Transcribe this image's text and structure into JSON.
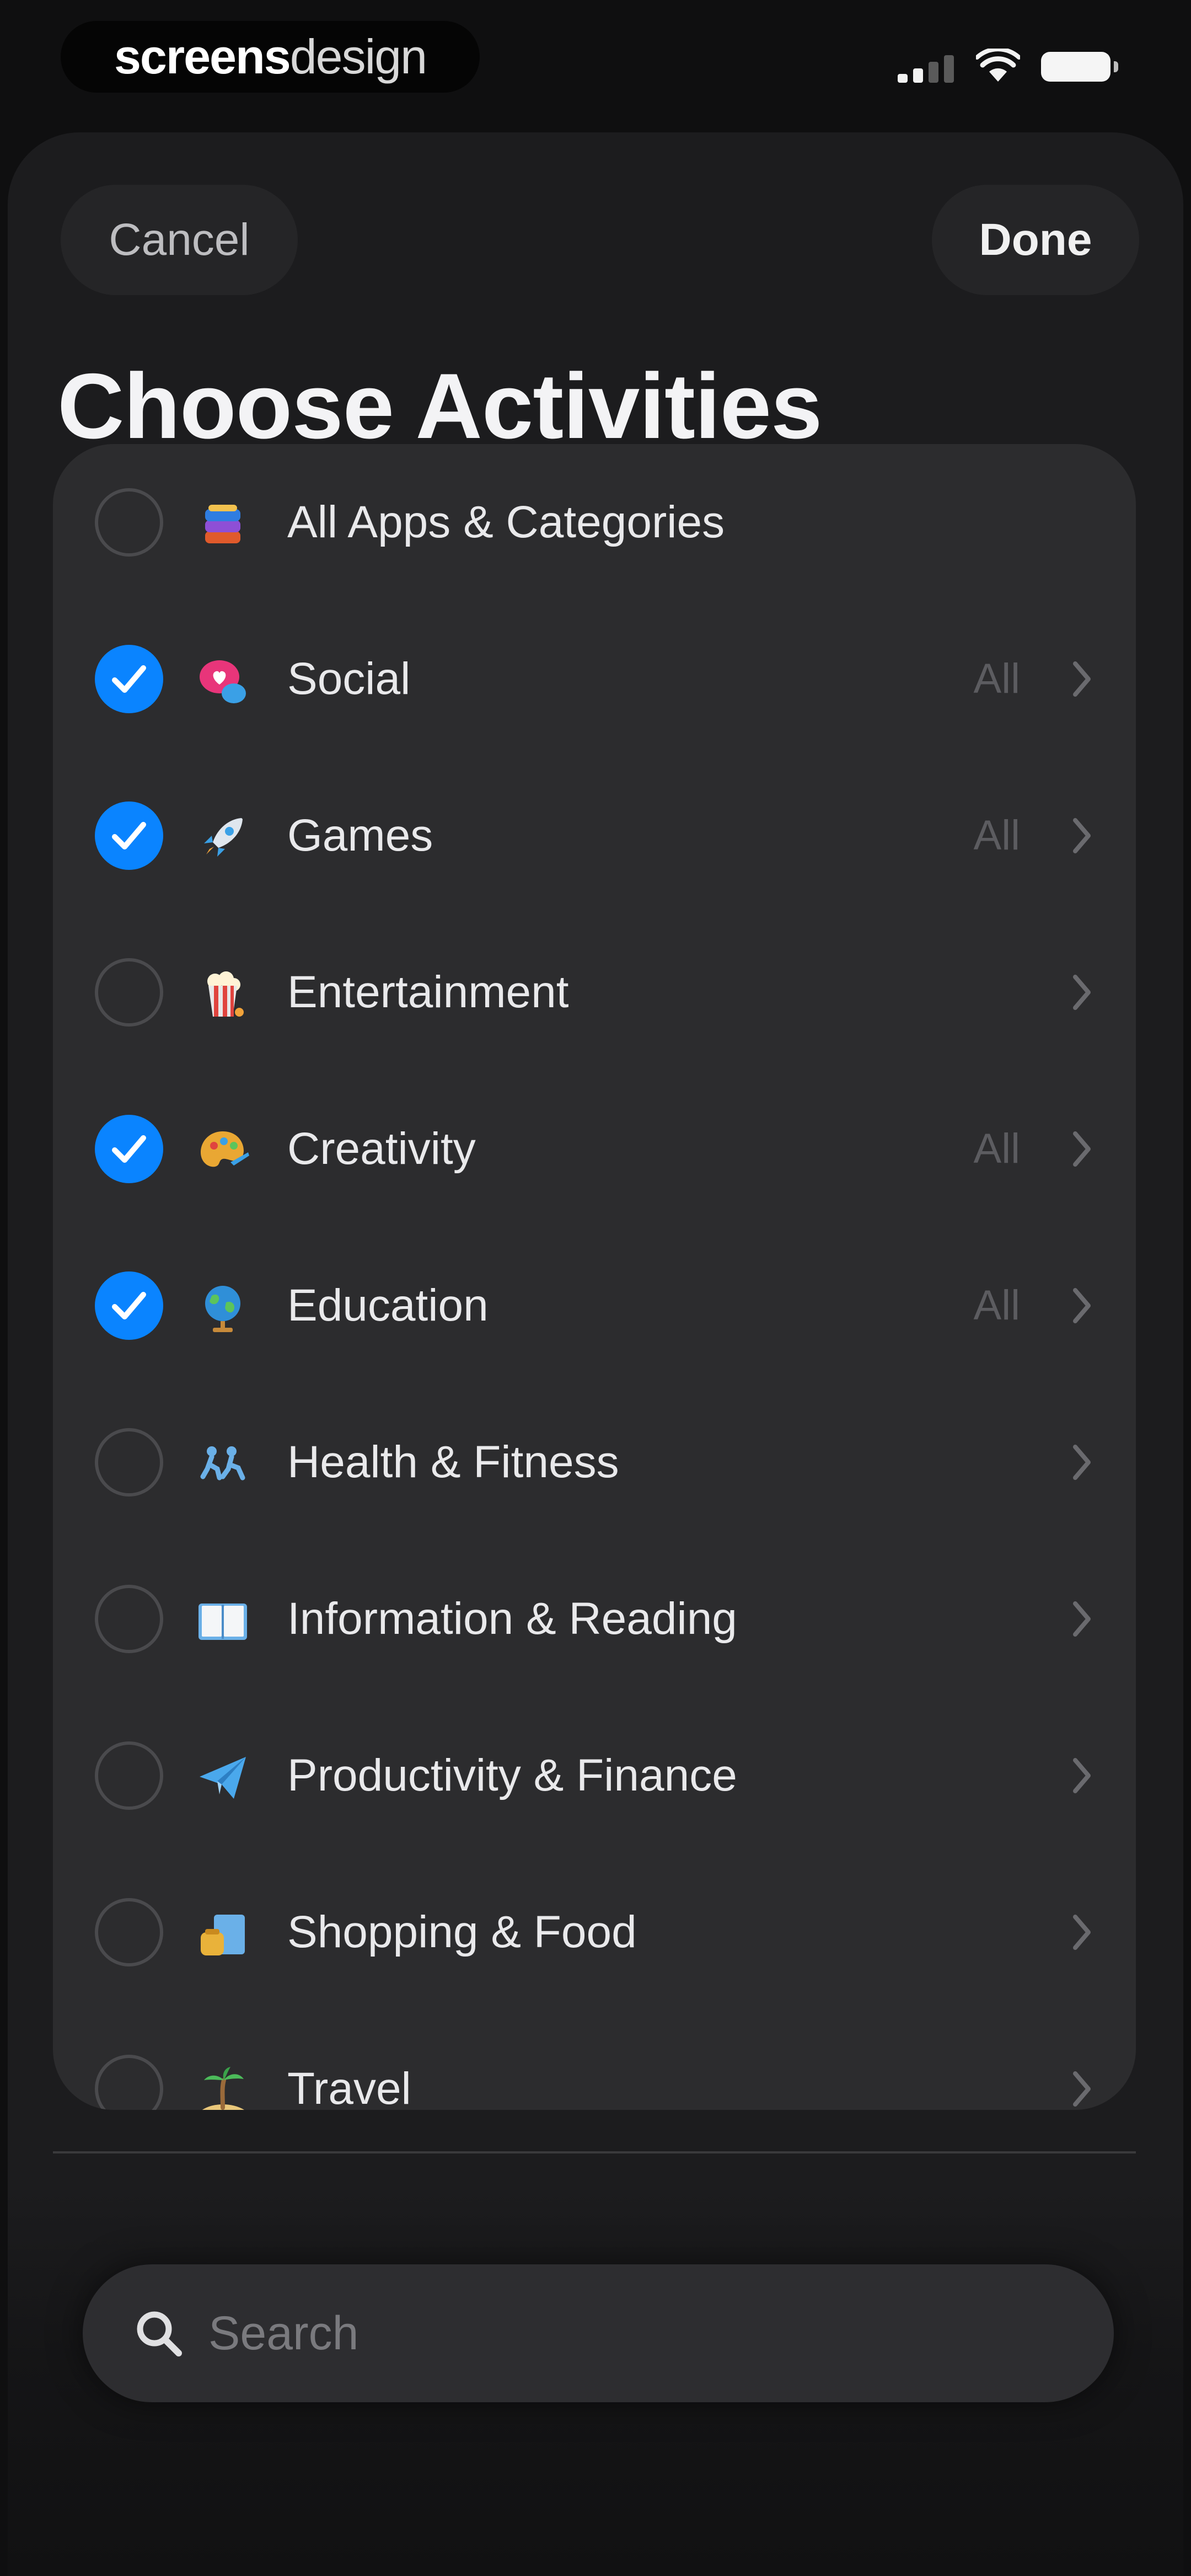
{
  "status_bar": {
    "brand_bold": "screens",
    "brand_light": "design"
  },
  "header": {
    "cancel_label": "Cancel",
    "done_label": "Done",
    "title": "Choose Activities"
  },
  "categories": [
    {
      "label": "All Apps & Categories",
      "checked": false,
      "detail": "",
      "chevron": false,
      "icon": "stack-icon"
    },
    {
      "label": "Social",
      "checked": true,
      "detail": "All",
      "chevron": true,
      "icon": "speech-bubble-heart-icon"
    },
    {
      "label": "Games",
      "checked": true,
      "detail": "All",
      "chevron": true,
      "icon": "rocket-icon"
    },
    {
      "label": "Entertainment",
      "checked": false,
      "detail": "",
      "chevron": true,
      "icon": "popcorn-icon"
    },
    {
      "label": "Creativity",
      "checked": true,
      "detail": "All",
      "chevron": true,
      "icon": "palette-icon"
    },
    {
      "label": "Education",
      "checked": true,
      "detail": "All",
      "chevron": true,
      "icon": "globe-icon"
    },
    {
      "label": "Health & Fitness",
      "checked": false,
      "detail": "",
      "chevron": true,
      "icon": "runners-icon"
    },
    {
      "label": "Information & Reading",
      "checked": false,
      "detail": "",
      "chevron": true,
      "icon": "book-icon"
    },
    {
      "label": "Productivity & Finance",
      "checked": false,
      "detail": "",
      "chevron": true,
      "icon": "paper-plane-icon"
    },
    {
      "label": "Shopping & Food",
      "checked": false,
      "detail": "",
      "chevron": true,
      "icon": "shopping-bag-icon"
    },
    {
      "label": "Travel",
      "checked": false,
      "detail": "",
      "chevron": true,
      "icon": "palm-tree-icon"
    }
  ],
  "search": {
    "placeholder": "Search"
  },
  "colors": {
    "accent": "#0a84ff",
    "background": "#0f0f10",
    "sheet": "#1c1c1e",
    "card": "#2c2c2e"
  }
}
